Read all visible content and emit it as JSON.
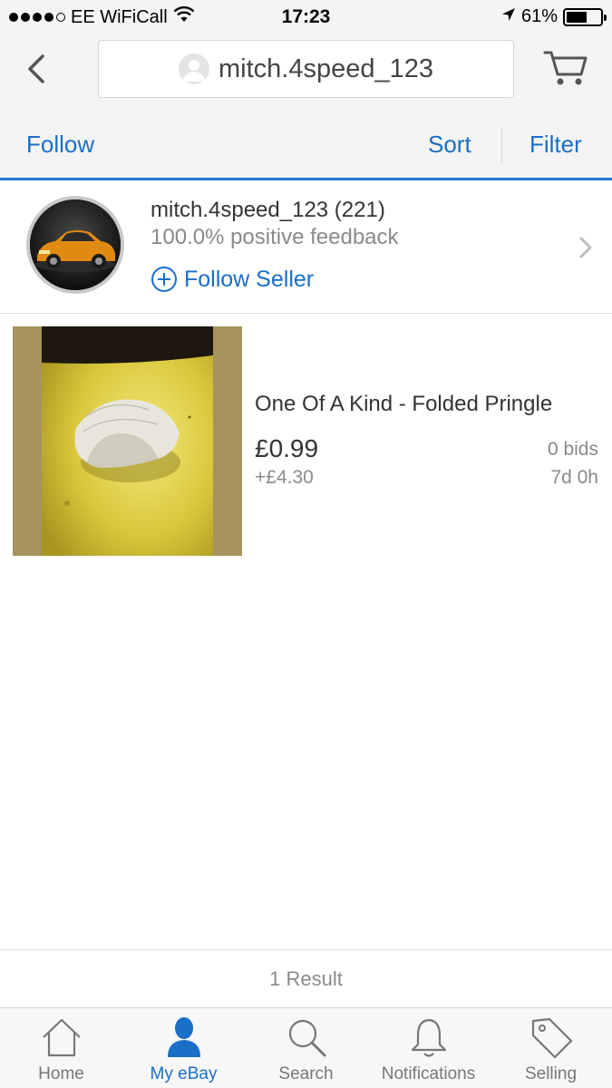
{
  "status_bar": {
    "carrier": "EE WiFiCall",
    "time": "17:23",
    "battery": "61%",
    "battery_level": 0.61
  },
  "header": {
    "search_text": "mitch.4speed_123",
    "back_icon": "chevron-left-icon",
    "cart_icon": "cart-icon"
  },
  "action_bar": {
    "follow": "Follow",
    "sort": "Sort",
    "filter": "Filter"
  },
  "seller": {
    "name": "mitch.4speed_123 (221)",
    "feedback": "100.0% positive feedback",
    "follow_seller": "Follow Seller"
  },
  "listing": {
    "title": "One Of A Kind - Folded Pringle",
    "price": "£0.99",
    "shipping": "+£4.30",
    "bids": "0 bids",
    "time_left": "7d 0h"
  },
  "results": {
    "count_label": "1 Result"
  },
  "tabs": [
    {
      "label": "Home",
      "icon": "home-icon",
      "active": false
    },
    {
      "label": "My eBay",
      "icon": "person-icon",
      "active": true
    },
    {
      "label": "Search",
      "icon": "search-icon",
      "active": false
    },
    {
      "label": "Notifications",
      "icon": "bell-icon",
      "active": false
    },
    {
      "label": "Selling",
      "icon": "tag-icon",
      "active": false
    }
  ],
  "colors": {
    "accent": "#1a6fc7",
    "header_bg": "#f4f4f4",
    "muted_text": "#8a8a8a"
  }
}
